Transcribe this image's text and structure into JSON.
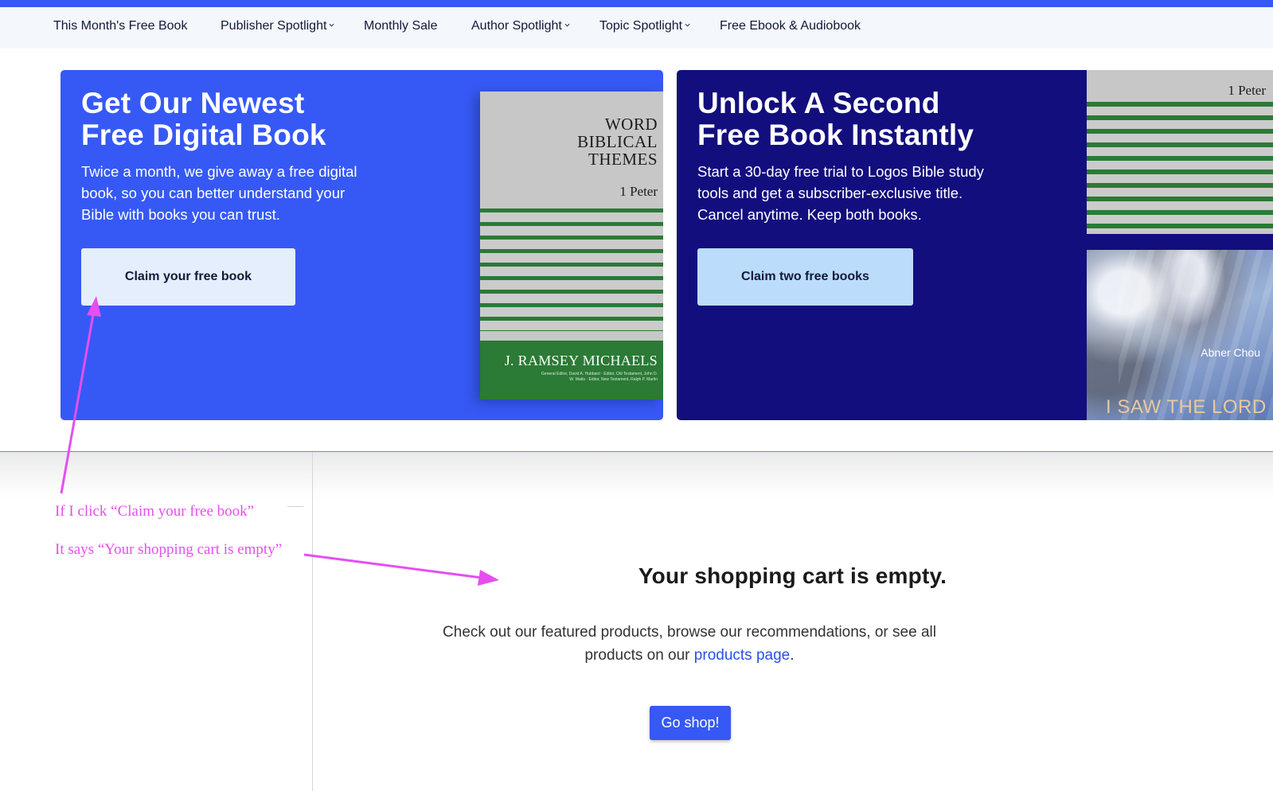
{
  "nav": {
    "items": [
      {
        "label": "This Month's Free Book",
        "dropdown": false
      },
      {
        "label": "Publisher Spotlight",
        "dropdown": true
      },
      {
        "label": "Monthly Sale",
        "dropdown": false
      },
      {
        "label": "Author Spotlight",
        "dropdown": true
      },
      {
        "label": "Topic Spotlight",
        "dropdown": true
      },
      {
        "label": "Free Ebook & Audiobook",
        "dropdown": false
      }
    ]
  },
  "hero": {
    "card1": {
      "title_line1": "Get Our Newest",
      "title_line2": "Free Digital Book",
      "description": "Twice a month, we give away a free digital book, so you can better understand your Bible with books you can trust.",
      "cta_label": "Claim your free book",
      "book": {
        "title_line1": "WORD",
        "title_line2": "BIBLICAL",
        "title_line3": "THEMES",
        "subtitle": "1 Peter",
        "author": "J. RAMSEY MICHAELS",
        "fine_print": "General Editor, David A. Hubbard · Editor, Old Testament, John D. W. Watts · Editor, New Testament, Ralph P. Martin"
      }
    },
    "card2": {
      "title_line1": "Unlock A Second",
      "title_line2": "Free Book Instantly",
      "description": "Start a 30-day free trial to Logos Bible study tools and get a subscriber-exclusive title. Cancel anytime. Keep both books.",
      "cta_label": "Claim two free books",
      "book_top_subtitle": "1 Peter",
      "book_bottom_author": "Abner Chou",
      "book_bottom_title": "I SAW THE LORD"
    }
  },
  "cart": {
    "title": "Your shopping cart is empty.",
    "message_before": "Check out our featured products, browse our recommendations, or see all products on our ",
    "link_label": "products page",
    "message_after": ".",
    "button_label": "Go shop!"
  },
  "annotations": {
    "note1": "If I click “Claim your free book”",
    "note2": "It says “Your shopping cart is empty”",
    "color": "#e64ef0"
  },
  "colors": {
    "primary_blue": "#3659f5",
    "dark_navy": "#130e7d",
    "book_green": "#2b7a35"
  }
}
